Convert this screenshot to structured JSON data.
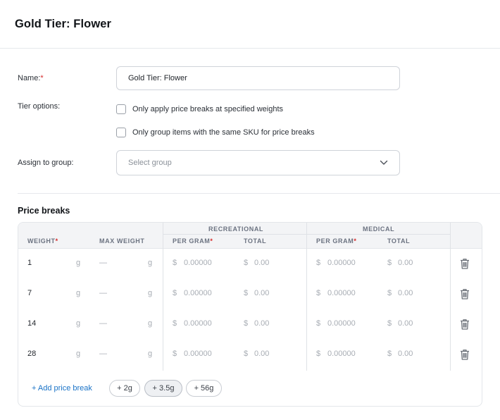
{
  "title": "Gold Tier: Flower",
  "form": {
    "name_label": "Name:",
    "name_value": "Gold Tier: Flower",
    "tier_options_label": "Tier options:",
    "option1": "Only apply price breaks at specified weights",
    "option2": "Only group items with the same SKU for price breaks",
    "assign_label": "Assign to group:",
    "group_placeholder": "Select group"
  },
  "price_breaks": {
    "title": "Price breaks",
    "headers": {
      "weight": "WEIGHT",
      "max_weight": "MAX WEIGHT",
      "recreational": "RECREATIONAL",
      "medical": "MEDICAL",
      "per_gram": "PER GRAM",
      "total": "TOTAL"
    },
    "required_marker": "*",
    "unit": "g",
    "dash": "—",
    "currency": "$",
    "rows": [
      {
        "weight": "1",
        "rec_per_gram": "0.00000",
        "rec_total": "0.00",
        "med_per_gram": "0.00000",
        "med_total": "0.00"
      },
      {
        "weight": "7",
        "rec_per_gram": "0.00000",
        "rec_total": "0.00",
        "med_per_gram": "0.00000",
        "med_total": "0.00"
      },
      {
        "weight": "14",
        "rec_per_gram": "0.00000",
        "rec_total": "0.00",
        "med_per_gram": "0.00000",
        "med_total": "0.00"
      },
      {
        "weight": "28",
        "rec_per_gram": "0.00000",
        "rec_total": "0.00",
        "med_per_gram": "0.00000",
        "med_total": "0.00"
      }
    ],
    "add_link": "+ Add price break",
    "chips": [
      "+ 2g",
      "+ 3.5g",
      "+ 56g"
    ]
  },
  "colors": {
    "accent": "#1a73c7",
    "required": "#d62a2a"
  },
  "icons": {
    "trash": "trash-icon",
    "chevron": "chevron-down-icon"
  }
}
